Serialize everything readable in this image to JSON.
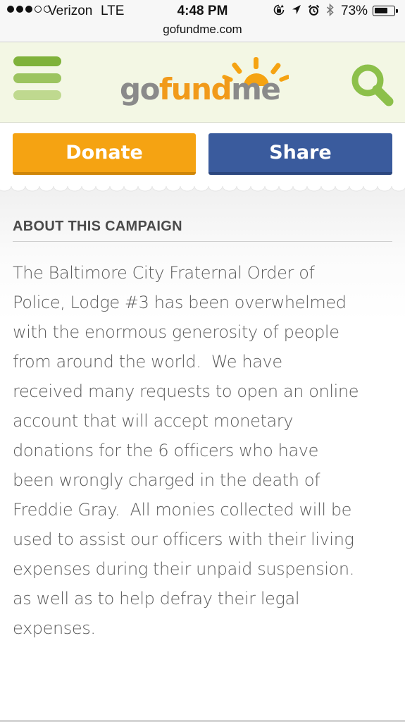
{
  "status_bar": {
    "signal_dots_filled": 3,
    "signal_dots_total": 5,
    "carrier": "Verizon",
    "network": "LTE",
    "time": "4:48 PM",
    "status_icons": [
      "screen-rotation-lock-icon",
      "location-arrow-icon",
      "alarm-icon",
      "bluetooth-icon"
    ],
    "battery_percent": "73%",
    "battery_level": 0.73
  },
  "browser": {
    "url": "gofundme.com"
  },
  "header": {
    "logo": {
      "go": "go",
      "fund": "fund",
      "me": "me"
    },
    "menu_icon": "hamburger-menu-icon",
    "search_icon": "search-icon",
    "colors": {
      "header_bg": "#f3f7e4",
      "brand_green": "#7fb23a",
      "brand_orange": "#f19a1a",
      "logo_gray": "#8a8a8a"
    }
  },
  "actions": {
    "donate_label": "Donate",
    "share_label": "Share",
    "colors": {
      "donate": "#f5a312",
      "share": "#3a5b9d"
    }
  },
  "campaign": {
    "section_title": "ABOUT THIS CAMPAIGN",
    "story": [
      "The Baltimore City Fraternal Order of",
      "Police, Lodge #3 has been overwhelmed",
      "with the enormous generosity of people",
      "from around the world.  We have",
      "received many requests to open an online",
      "account that will accept monetary",
      "donations for the 6 officers who have",
      "been wrongly charged in the death of",
      "Freddie Gray.  All monies collected will be",
      "used to assist our officers with their living",
      "expenses during their unpaid suspension.",
      "as well as to help defray their legal",
      "expenses."
    ]
  }
}
